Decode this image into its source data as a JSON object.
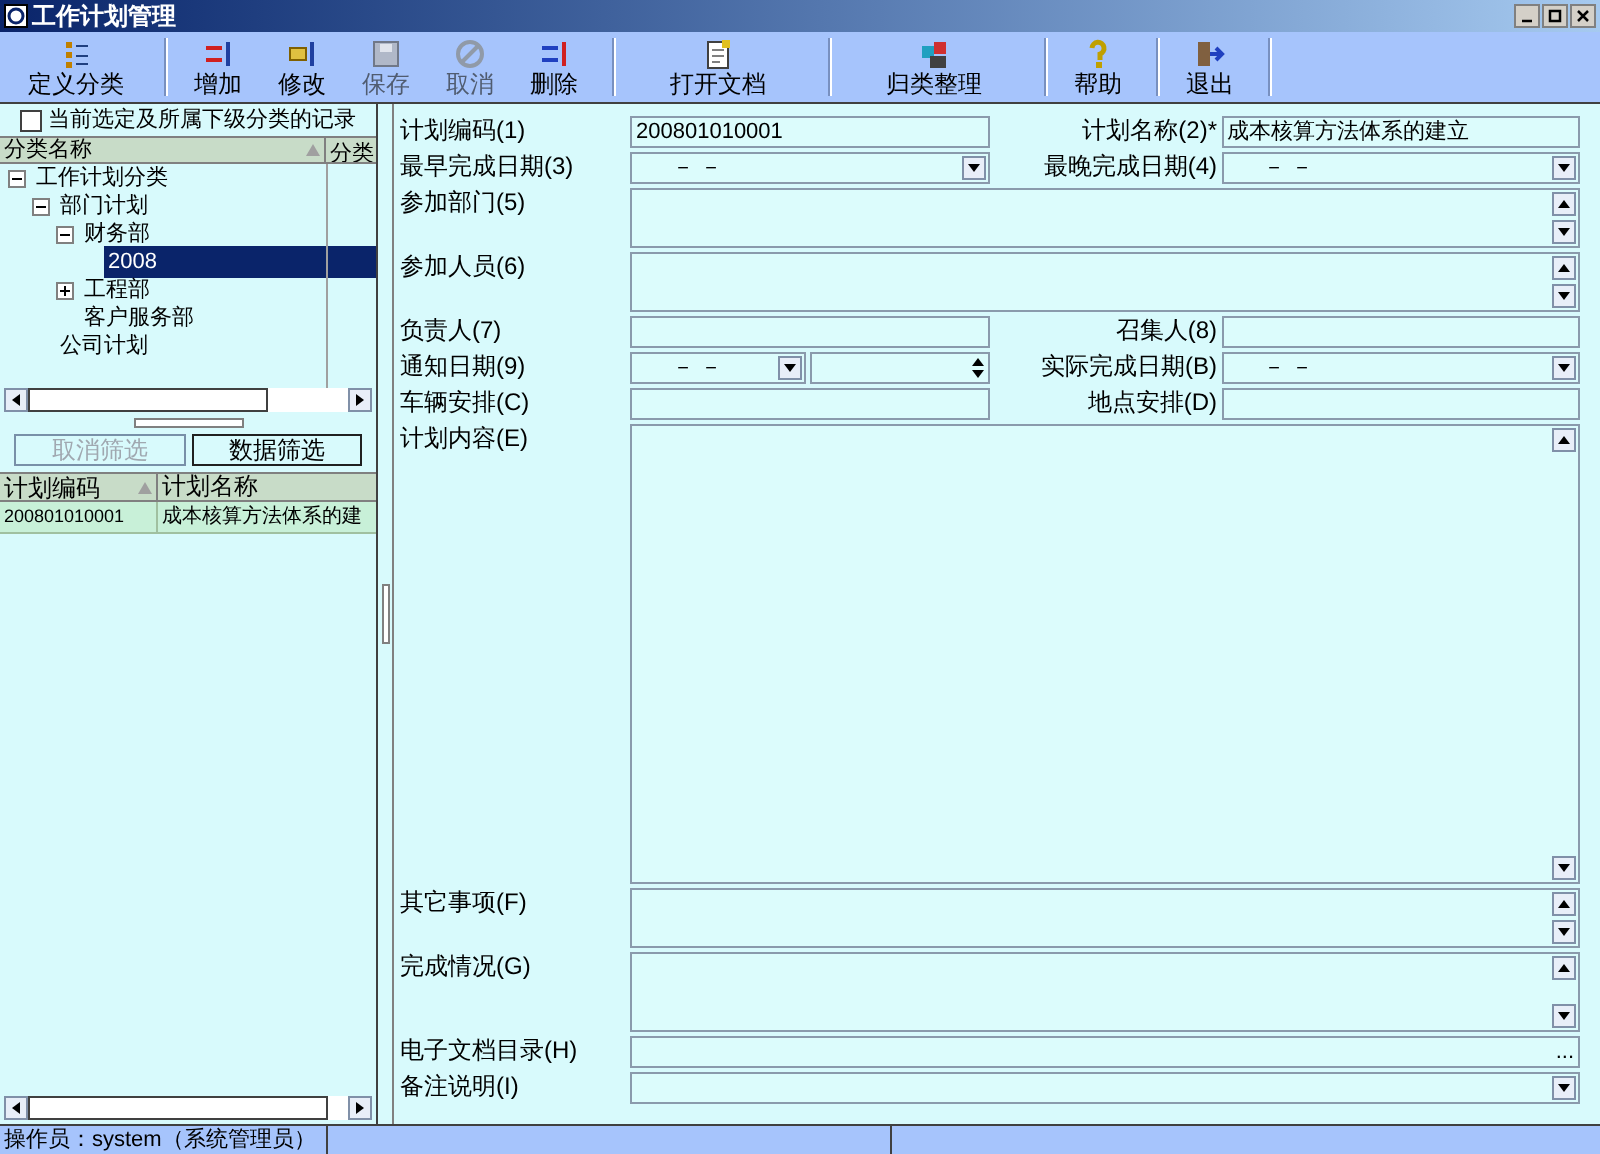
{
  "window": {
    "title": "工作计划管理"
  },
  "toolbar": [
    {
      "label": "定义分类",
      "disabled": false,
      "group_end": true
    },
    {
      "label": "增加",
      "disabled": false,
      "group_end": false
    },
    {
      "label": "修改",
      "disabled": false,
      "group_end": false
    },
    {
      "label": "保存",
      "disabled": true,
      "group_end": false
    },
    {
      "label": "取消",
      "disabled": true,
      "group_end": false
    },
    {
      "label": "删除",
      "disabled": false,
      "group_end": true
    },
    {
      "label": "打开文档",
      "disabled": false,
      "group_end": true
    },
    {
      "label": "归类整理",
      "disabled": false,
      "group_end": true
    },
    {
      "label": "帮助",
      "disabled": false,
      "group_end": true
    },
    {
      "label": "退出",
      "disabled": false,
      "group_end": true
    }
  ],
  "sidebar": {
    "filter_checkbox": {
      "label": "当前选定及所属下级分类的记录",
      "checked": false
    },
    "tree_columns": [
      "分类名称",
      "分类"
    ],
    "tree": [
      {
        "label": "工作计划分类",
        "expanded": true,
        "selected": false,
        "children": [
          {
            "label": "部门计划",
            "expanded": true,
            "selected": false,
            "children": [
              {
                "label": "财务部",
                "expanded": true,
                "selected": false,
                "children": [
                  {
                    "label": "2008",
                    "selected": true
                  }
                ]
              },
              {
                "label": "工程部",
                "expanded": false,
                "selected": false
              },
              {
                "label": "客户服务部",
                "selected": false
              }
            ]
          },
          {
            "label": "公司计划",
            "selected": false
          }
        ]
      }
    ],
    "buttons": [
      {
        "label": "取消筛选",
        "disabled": true
      },
      {
        "label": "数据筛选",
        "disabled": false
      }
    ],
    "table": {
      "columns": [
        "计划编码",
        "计划名称"
      ],
      "rows": [
        [
          "200801010001",
          "成本核算方法体系的建"
        ]
      ]
    }
  },
  "form": [
    [
      {
        "label": "计划编码(1)",
        "kind": "text",
        "value": "200801010001"
      },
      {
        "label": "计划名称(2)*",
        "kind": "text",
        "value": "成本核算方法体系的建立"
      }
    ],
    [
      {
        "label": "最早完成日期(3)",
        "kind": "date",
        "value": "－ －"
      },
      {
        "label": "最晚完成日期(4)",
        "kind": "date",
        "value": "－ －"
      }
    ],
    [
      {
        "label": "参加部门(5)",
        "kind": "memo"
      }
    ],
    [
      {
        "label": "参加人员(6)",
        "kind": "memo"
      }
    ],
    [
      {
        "label": "负责人(7)",
        "kind": "text"
      },
      {
        "label": "召集人(8)",
        "kind": "text"
      }
    ],
    [
      {
        "label": "通知日期(9)",
        "kind": "datetime",
        "value": "－ －"
      },
      {
        "label": "实际完成日期(B)",
        "kind": "date",
        "value": "－ －"
      }
    ],
    [
      {
        "label": "车辆安排(C)",
        "kind": "text"
      },
      {
        "label": "地点安排(D)",
        "kind": "text"
      }
    ],
    [
      {
        "label": "计划内容(E)",
        "kind": "bigmemo"
      }
    ],
    [
      {
        "label": "其它事项(F)",
        "kind": "memo"
      }
    ],
    [
      {
        "label": "完成情况(G)",
        "kind": "tallmemo"
      }
    ],
    [
      {
        "label": "电子文档目录(H)",
        "kind": "browse",
        "button": "..."
      }
    ],
    [
      {
        "label": "备注说明(I)",
        "kind": "combo"
      }
    ]
  ],
  "status_bar": [
    "操作员：system（系统管理员）"
  ]
}
